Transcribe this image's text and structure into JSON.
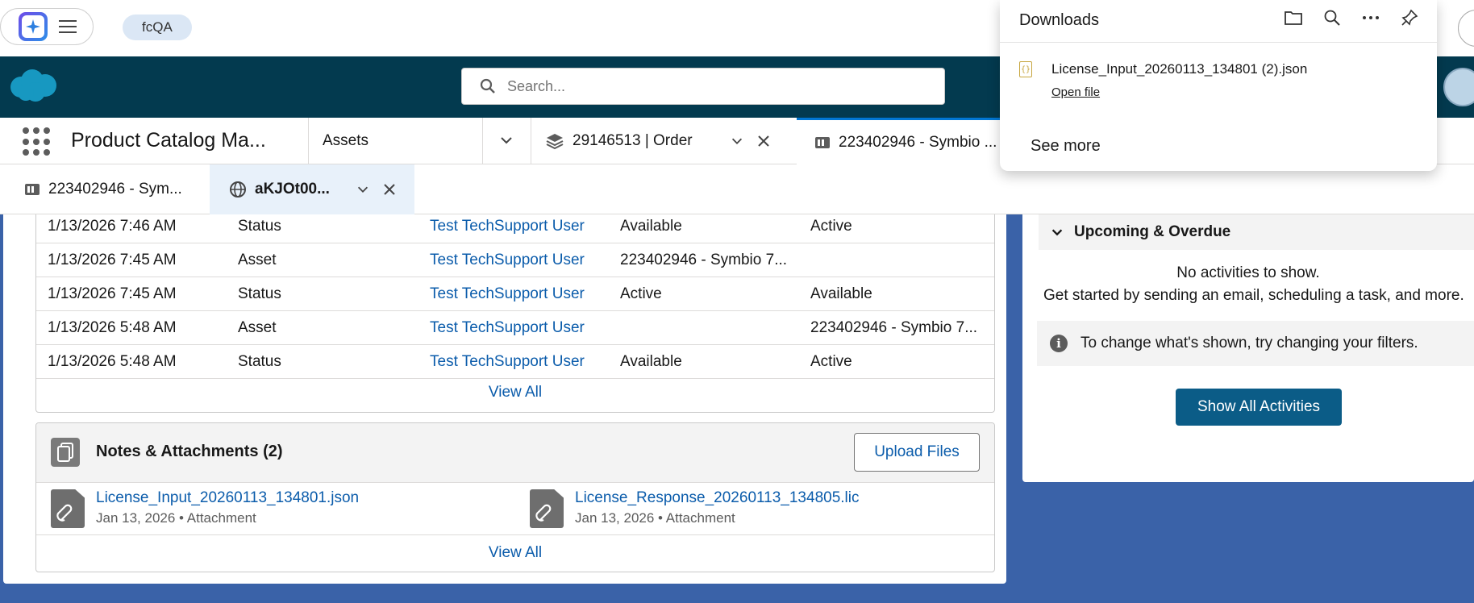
{
  "browser": {
    "workspace": "fcQA"
  },
  "downloads": {
    "title": "Downloads",
    "file_name": "License_Input_20260113_134801 (2).json",
    "open_file": "Open file",
    "see_more": "See more",
    "icons": [
      "folder-icon",
      "search-icon",
      "more-icon",
      "pin-icon"
    ]
  },
  "header": {
    "search_placeholder": "Search..."
  },
  "nav": {
    "app_name": "Product Catalog Ma...",
    "assets": "Assets",
    "tab_order": "29146513 | Order",
    "tab_asset": "223402946 - Symbio ..."
  },
  "subtabs": {
    "tab1": "223402946 - Sym...",
    "tab2": "aKJOt00..."
  },
  "history": {
    "rows": [
      {
        "date": "1/13/2026 7:46 AM",
        "field": "Status",
        "user": "Test TechSupport User",
        "original": "Available",
        "new": "Active"
      },
      {
        "date": "1/13/2026 7:45 AM",
        "field": "Asset",
        "user": "Test TechSupport User",
        "original": "223402946 - Symbio 7...",
        "new": ""
      },
      {
        "date": "1/13/2026 7:45 AM",
        "field": "Status",
        "user": "Test TechSupport User",
        "original": "Active",
        "new": "Available"
      },
      {
        "date": "1/13/2026 5:48 AM",
        "field": "Asset",
        "user": "Test TechSupport User",
        "original": "",
        "new": "223402946 - Symbio 7..."
      },
      {
        "date": "1/13/2026 5:48 AM",
        "field": "Status",
        "user": "Test TechSupport User",
        "original": "Available",
        "new": "Active"
      }
    ],
    "view_all": "View All"
  },
  "notes": {
    "title": "Notes & Attachments (2)",
    "upload": "Upload Files",
    "files": [
      {
        "name": "License_Input_20260113_134801.json",
        "meta": "Jan 13, 2026 • Attachment"
      },
      {
        "name": "License_Response_20260113_134805.lic",
        "meta": "Jan 13, 2026 • Attachment"
      }
    ],
    "view_all": "View All"
  },
  "activity": {
    "section": "Upcoming & Overdue",
    "no_activities": "No activities to show.",
    "get_started": "Get started by sending an email, scheduling a task, and more.",
    "filter_note": "To change what's shown, try changing your filters.",
    "show_all": "Show All Activities"
  },
  "colors": {
    "header_bg": "#033a4f",
    "content_bg": "#3a62a8",
    "link": "#0b5cab",
    "brand_button": "#0b5c87"
  }
}
